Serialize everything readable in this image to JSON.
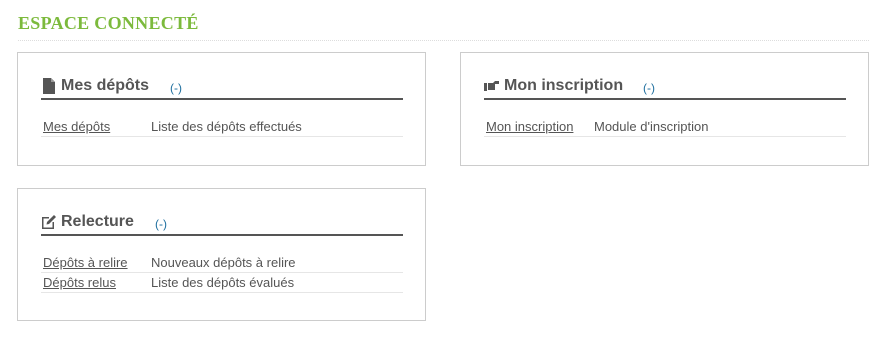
{
  "page": {
    "title": "ESPACE CONNECTÉ"
  },
  "panels": {
    "depots": {
      "title": "Mes dépôts",
      "toggle": "(-)",
      "icon": "document-icon",
      "rows": [
        {
          "link": "Mes dépôts",
          "description": "Liste des dépôts effectués"
        }
      ]
    },
    "inscription": {
      "title": "Mon inscription",
      "toggle": "(-)",
      "icon": "hand-pointing-icon",
      "rows": [
        {
          "link": "Mon inscription",
          "description": "Module d'inscription"
        }
      ]
    },
    "relecture": {
      "title": "Relecture",
      "toggle": "(-)",
      "icon": "edit-icon",
      "rows": [
        {
          "link": "Dépôts à relire",
          "description": "Nouveaux dépôts à relire"
        },
        {
          "link": "Dépôts relus",
          "description": "Liste des dépôts évalués"
        }
      ]
    }
  },
  "colors": {
    "title_green": "#7cba3c",
    "toggle_blue": "#1f6f9f",
    "text_gray": "#555555"
  }
}
